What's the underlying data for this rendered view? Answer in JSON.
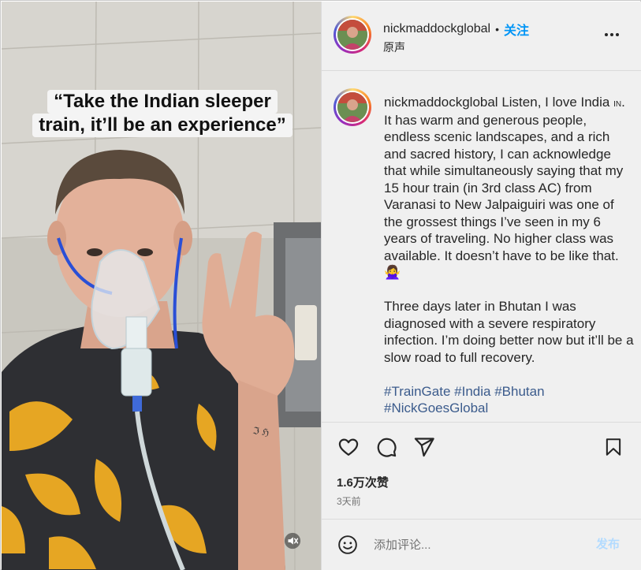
{
  "media": {
    "caption_line1": "“Take the Indian sleeper",
    "caption_line2": "train, it’ll be an experience”",
    "mute_icon": "speaker-muted-icon"
  },
  "header": {
    "username": "nickmaddockglobal",
    "separator": "•",
    "follow_label": "关注",
    "audio_label": "原声",
    "more_icon": "more-horizontal-icon"
  },
  "caption": {
    "username": "nickmaddockglobal",
    "paragraph1_start": "Listen, I love India",
    "country_code": "in",
    "paragraph1_rest": ". It has warm and generous people, endless scenic landscapes, and a rich and sacred history, I can acknowledge that while simultaneously saying that my 15 hour train (in 3rd class AC) from Varanasi to New Jalpaiguiri was one of the grossest things I’ve seen in my 6 years of traveling. No higher class was available. It doesn’t have to be like that.",
    "paragraph1_emoji": "🙅‍♀️",
    "paragraph2": "Three days later in Bhutan I was diagnosed with a severe respiratory infection. I’m doing better now but it’ll be a slow road to full recovery.",
    "hashtags": [
      "#TrainGate",
      "#India",
      "#Bhutan",
      "#NickGoesGlobal"
    ]
  },
  "actions": {
    "like_icon": "heart-icon",
    "comment_icon": "comment-bubble-icon",
    "share_icon": "paper-plane-icon",
    "save_icon": "bookmark-icon",
    "likes_label": "1.6万次赞",
    "time_label": "3天前"
  },
  "add_comment": {
    "emoji_icon": "smiley-icon",
    "placeholder": "添加评论...",
    "post_label": "发布"
  },
  "colors": {
    "accent": "#0095f6",
    "post_disabled": "#b3dbff",
    "hashtag": "#3b5b8c",
    "panel_bg": "#f0f0f0"
  }
}
